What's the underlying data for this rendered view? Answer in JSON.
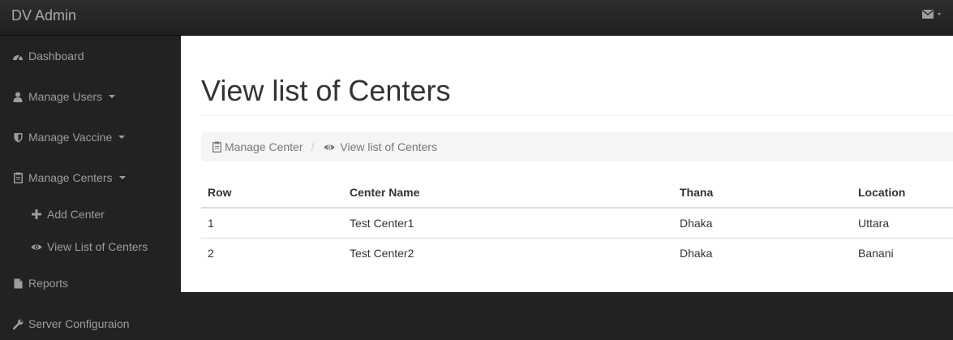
{
  "app": {
    "brand": "DV Admin"
  },
  "topbar": {
    "icons": [
      "envelope-icon",
      "caret-down-icon"
    ]
  },
  "sidebar": {
    "items": [
      {
        "label": "Dashboard",
        "icon": "dashboard-icon"
      },
      {
        "label": "Manage Users",
        "icon": "user-icon",
        "has_caret": true
      },
      {
        "label": "Manage Vaccine",
        "icon": "shield-icon",
        "has_caret": true
      },
      {
        "label": "Manage Centers",
        "icon": "clipboard-icon",
        "has_caret": true
      },
      {
        "label": "Add Center",
        "icon": "plus-icon"
      },
      {
        "label": "View List of Centers",
        "icon": "eye-icon"
      },
      {
        "label": "Reports",
        "icon": "file-icon"
      },
      {
        "label": "Server Configuraion",
        "icon": "wrench-icon"
      }
    ]
  },
  "main": {
    "title": "View list of Centers",
    "breadcrumb": [
      {
        "label": "Manage Center",
        "icon": "clipboard-icon"
      },
      {
        "label": "View list of Centers",
        "icon": "eye-icon"
      }
    ],
    "breadcrumb_separator": "/",
    "table": {
      "headers": [
        "Row",
        "Center Name",
        "Thana",
        "Location"
      ],
      "rows": [
        [
          "1",
          "Test Center1",
          "Dhaka",
          "Uttara"
        ],
        [
          "2",
          "Test Center2",
          "Dhaka",
          "Banani"
        ]
      ]
    }
  },
  "colors": {
    "topbar_bg": "#222222",
    "sidebar_bg": "#222222",
    "sidebar_text": "#9d9d9d",
    "content_bg": "#ffffff",
    "breadcrumb_bg": "#f5f5f5"
  }
}
